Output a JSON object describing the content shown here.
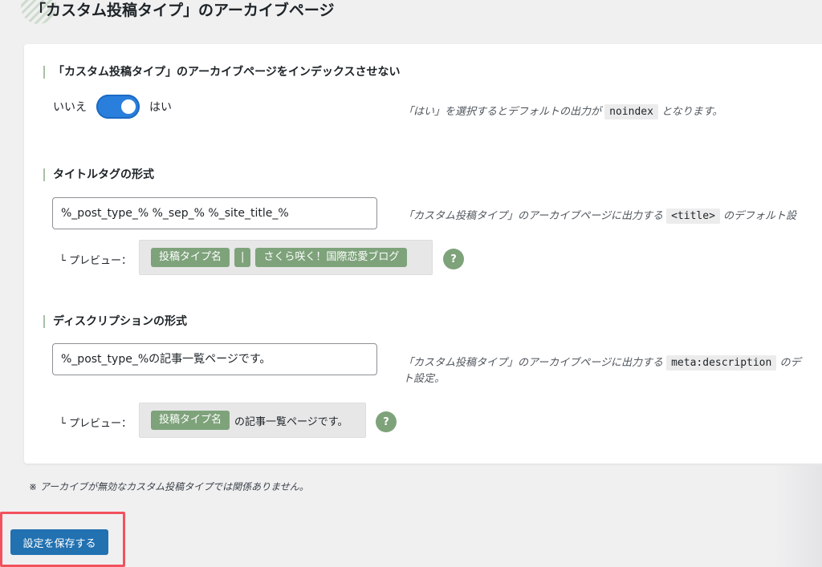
{
  "page": {
    "title": "「カスタム投稿タイプ」のアーカイブページ"
  },
  "noindex": {
    "heading": "「カスタム投稿タイプ」のアーカイブページをインデックスさせない",
    "label_off": "いいえ",
    "label_on": "はい",
    "toggle_on": true,
    "desc_before": "「はい」を選択するとデフォルトの出力が",
    "desc_code": "noindex",
    "desc_after": "となります。"
  },
  "title_format": {
    "heading": "タイトルタグの形式",
    "value": "%_post_type_% %_sep_% %_site_title_%",
    "desc_before": "「カスタム投稿タイプ」のアーカイブページに出力する",
    "desc_code": "<title>",
    "desc_after": "のデフォルト設",
    "preview_label": "└ プレビュー：",
    "preview_chips": [
      "投稿タイプ名",
      "|",
      "さくら咲く！国際恋愛ブログ"
    ],
    "help": "?"
  },
  "description_format": {
    "heading": "ディスクリプションの形式",
    "value": "%_post_type_%の記事一覧ページです。",
    "desc_before": "「カスタム投稿タイプ」のアーカイブページに出力する",
    "desc_code": "meta:description",
    "desc_after": "のデ",
    "desc_line2": "ト設定。",
    "preview_label": "└ プレビュー：",
    "preview_chip": "投稿タイプ名",
    "preview_text": "の記事一覧ページです。",
    "help": "?"
  },
  "note": "※ アーカイブが無効なカスタム投稿タイプでは関係ありません。",
  "save_button": "設定を保存する",
  "colors": {
    "accent_blue": "#2271b1",
    "toggle_blue": "#2a7fdc",
    "chip_green": "#7ea37b",
    "highlight_red": "#f2525d"
  }
}
